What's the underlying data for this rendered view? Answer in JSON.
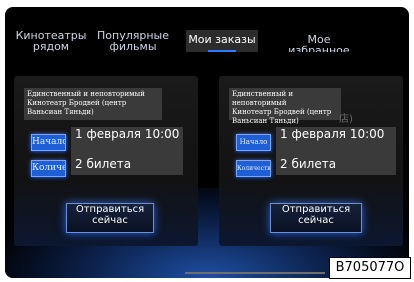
{
  "tabs": [
    {
      "label": "Кинотеатры рядом",
      "active": false
    },
    {
      "label": "Популярные фильмы",
      "active": false
    },
    {
      "label": "Мои заказы",
      "active": true
    },
    {
      "label": "Мое избранное",
      "active": false
    }
  ],
  "orders": [
    {
      "title": "Единственный и неповторимый\nКинотеатр Бродвей (центр Ваньсиан Тяньди)",
      "start_label": "Начало",
      "start_value": "1 февраля 10:00",
      "qty_label": "Количе",
      "qty_value": "2 билета",
      "action": "Отправиться сейчас"
    },
    {
      "title": "Единственный и неповторимый\nКинотеатр Бродвей (центр Ваньсиан Тяньди)",
      "ghost": "店)",
      "start_label": "Начало",
      "start_value": "1 февраля 10:00",
      "qty_label": "Количеств",
      "qty_value": "2 билета",
      "action": "Отправиться сейчас"
    }
  ],
  "figure_code": "B705077O",
  "colors": {
    "accent": "#1f5fd6",
    "background": "#000000",
    "panel": "#3a3a3a"
  }
}
